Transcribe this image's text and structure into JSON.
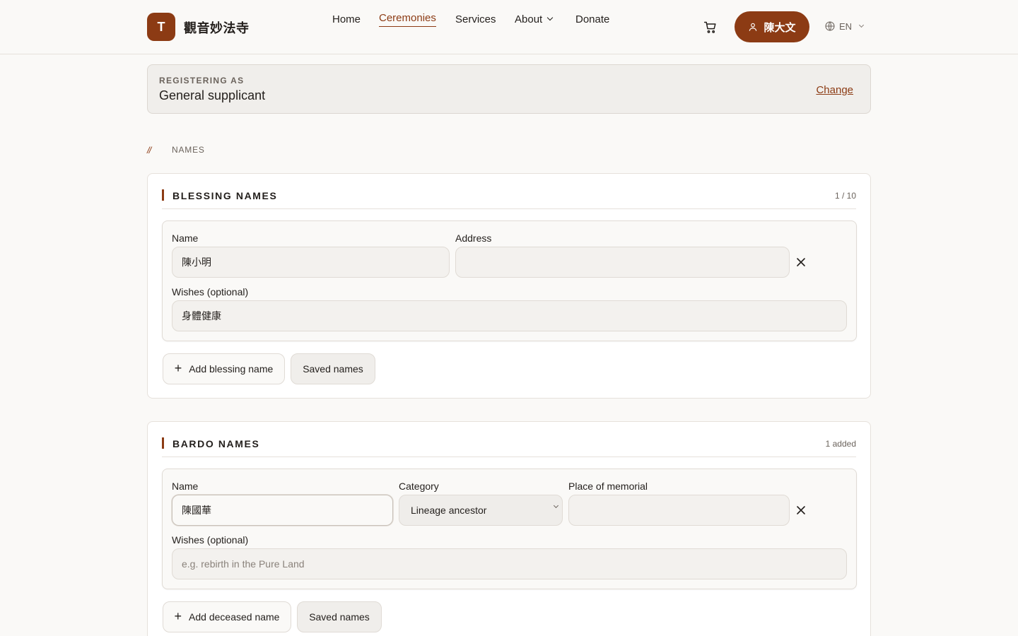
{
  "header": {
    "logo_letter": "T",
    "brand": "觀音妙法寺",
    "nav": {
      "home": "Home",
      "ceremonies": "Ceremonies",
      "services": "Services",
      "about": "About",
      "donate": "Donate"
    },
    "user_name": "陳大文",
    "language": "EN"
  },
  "registering": {
    "caption": "REGISTERING AS",
    "value": "General supplicant",
    "change": "Change"
  },
  "breadcrumb": {
    "slash": "//",
    "label": "NAMES"
  },
  "blessing": {
    "title": "BLESSING NAMES",
    "count": "1 / 10",
    "name_label": "Name",
    "name_value": "陳小明",
    "address_label": "Address",
    "address_value": "",
    "wishes_label": "Wishes (optional)",
    "wishes_value": "身體健康",
    "add_label": "Add blessing name",
    "saved_label": "Saved names"
  },
  "bardo": {
    "title": "BARDO NAMES",
    "count": "1 added",
    "name_label": "Name",
    "name_value": "陳國華",
    "category_label": "Category",
    "category_value": "Lineage ancestor",
    "place_label": "Place of memorial",
    "place_value": "",
    "wishes_label": "Wishes (optional)",
    "wishes_placeholder": "e.g. rebirth in the Pure Land",
    "add_label": "Add deceased name",
    "saved_label": "Saved names"
  },
  "colors": {
    "accent": "#8c3b14",
    "background": "#faf9f7",
    "text": "#231f1c"
  },
  "icons": [
    "cart-icon",
    "user-icon",
    "globe-icon",
    "chevron-down-icon",
    "close-icon",
    "plus-icon"
  ]
}
